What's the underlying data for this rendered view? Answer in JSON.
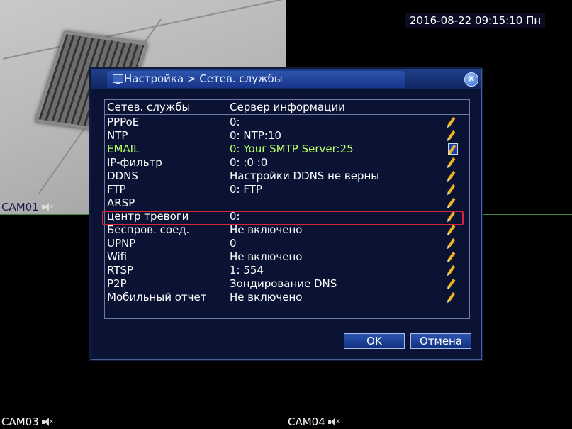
{
  "datetime": "2016-08-22 09:15:10 Пн",
  "cameras": [
    {
      "label": "CAM01"
    },
    {
      "label": "CAM03"
    },
    {
      "label": "CAM04"
    }
  ],
  "dialog": {
    "title": "Настройка > Сетев. службы",
    "columns": [
      "Сетев. службы",
      "Сервер информации"
    ],
    "rows": [
      {
        "service": "PPPoE",
        "info": "0:"
      },
      {
        "service": "NTP",
        "info": "0: NTP:10"
      },
      {
        "service": "EMAIL",
        "info": "0: Your SMTP Server:25"
      },
      {
        "service": "IP-фильтр",
        "info": "0: :0 :0"
      },
      {
        "service": "DDNS",
        "info": "Настройки DDNS не верны"
      },
      {
        "service": "FTP",
        "info": "0: FTP"
      },
      {
        "service": "ARSP",
        "info": ""
      },
      {
        "service": "центр тревоги",
        "info": "0:"
      },
      {
        "service": "Беспров. соед.",
        "info": "Не включено"
      },
      {
        "service": "UPNP",
        "info": "0"
      },
      {
        "service": "Wifi",
        "info": "Не включено"
      },
      {
        "service": "RTSP",
        "info": "1: 554"
      },
      {
        "service": "P2P",
        "info": "Зондирование DNS"
      },
      {
        "service": "Мобильный отчет",
        "info": "Не включено"
      }
    ],
    "ok_label": "OK",
    "cancel_label": "Отмена"
  },
  "colors": {
    "selected_text": "#b8ff6a",
    "selection_border": "#d8233a",
    "dialog_bg": "#0a1333"
  }
}
